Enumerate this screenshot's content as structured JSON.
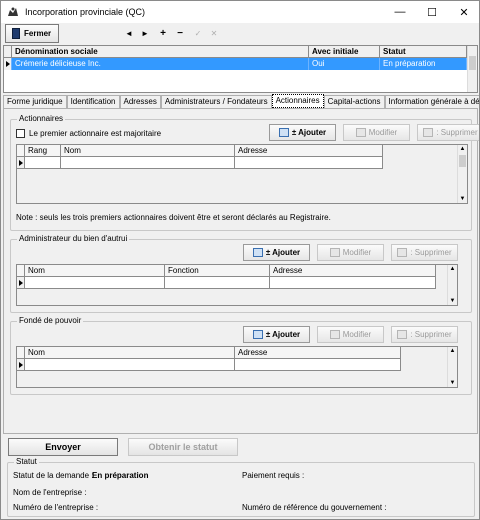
{
  "window": {
    "title": "Incorporation provinciale (QC)",
    "minimize": "—",
    "maximize": "☐",
    "close": "✕"
  },
  "toolbar": {
    "close_label": "Fermer",
    "nav": [
      "◄",
      "►",
      "+",
      "−",
      "✓",
      "✕"
    ]
  },
  "main_grid": {
    "columns": [
      "Dénomination sociale",
      "Avec initiale",
      "Statut"
    ],
    "rows": [
      [
        "Crémerie délicieuse Inc.",
        "Oui",
        "En préparation"
      ]
    ]
  },
  "tabs": [
    "Forme juridique",
    "Identification",
    "Adresses",
    "Administrateurs / Fondateurs",
    "Actionnaires",
    "Capital-actions",
    "Information générale à décl"
  ],
  "active_tab": "Actionnaires",
  "shareholders": {
    "title": "Actionnaires",
    "majority_label": "Le premier actionnaire est majoritaire",
    "add": "± Ajouter",
    "modify": "Modifier",
    "delete": ": Supprimer",
    "columns": [
      "Rang",
      "Nom",
      "Adresse"
    ],
    "note": "Note : seuls les trois premiers actionnaires doivent être et seront déclarés au Registraire."
  },
  "trustee": {
    "title": "Administrateur du bien d'autrui",
    "add": "± Ajouter",
    "modify": "Modifier",
    "delete": ": Supprimer",
    "columns": [
      "Nom",
      "Fonction",
      "Adresse"
    ]
  },
  "proxy": {
    "title": "Fondé de pouvoir",
    "add": "± Ajouter",
    "modify": "Modifier",
    "delete": ": Supprimer",
    "columns": [
      "Nom",
      "Adresse"
    ]
  },
  "actions": {
    "send": "Envoyer",
    "get_status": "Obtenir le statut"
  },
  "status": {
    "title": "Statut",
    "request_label": "Statut de la demande :",
    "request_value": "En préparation",
    "payment_label": "Paiement requis :",
    "company_name_label": "Nom de l'entreprise :",
    "company_number_label": "Numéro de l'entreprise :",
    "gov_ref_label": "Numéro de référence du gouvernement :"
  },
  "colors": {
    "selection": "#3399ff",
    "window_bg": "#f0f0f0"
  }
}
